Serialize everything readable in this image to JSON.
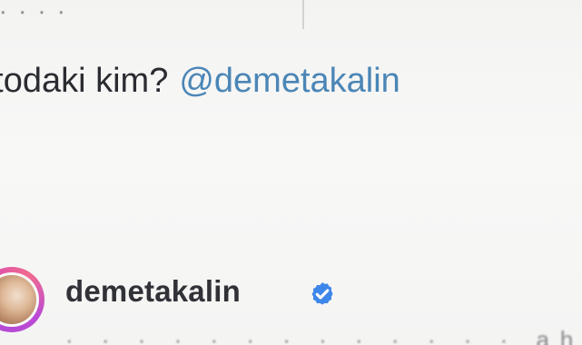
{
  "post": {
    "top_fragment": ". . . ."
  },
  "comment": {
    "text": "otodaki kim?",
    "mention": "@demetakalin"
  },
  "reply": {
    "username": "demetakalin",
    "avatar_icon": "profile-photo-icon",
    "verified_icon": "verified-badge-icon",
    "bottom_fragment": "· · · · · · · · · · · · · ahan",
    "colors": {
      "mention": "#4b86b6",
      "verified": "#3e87ea",
      "avatar_ring": "#c84bc6"
    }
  }
}
